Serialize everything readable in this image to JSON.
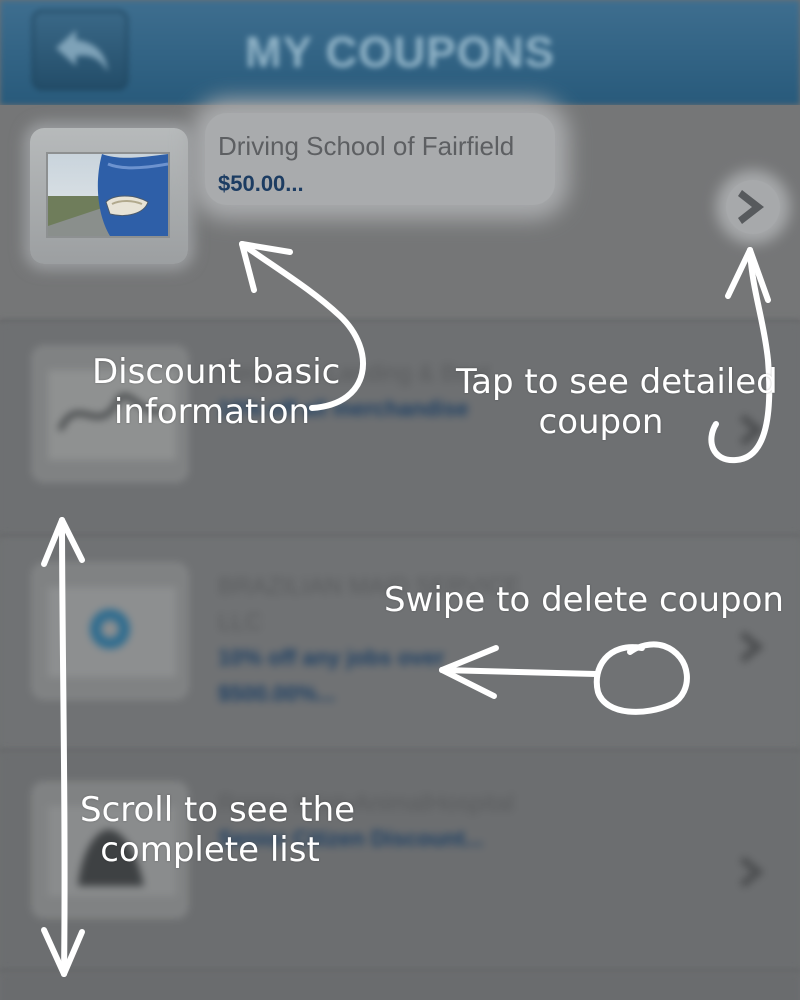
{
  "header": {
    "title": "MY COUPONS",
    "back_icon": "reply-arrow-icon"
  },
  "coupons": [
    {
      "merchant": "Driving School of Fairfield",
      "offer": "$50.00...",
      "thumbnail": "car-headlight-photo"
    },
    {
      "merchant": "Ferguson Landing & Boat",
      "offer": "10% off all merchandise"
    },
    {
      "merchant_line1": "BRAZILIAN MAID SERVICE",
      "merchant_line2": "LLC",
      "offer_line1": "10% off any jobs over",
      "offer_line2": "$500.00%..."
    },
    {
      "merchant": "Ronny KristyAnimalHospital",
      "offer": "Senior Citizen Discount..."
    }
  ],
  "annotations": {
    "discount_line1": "Discount basic",
    "discount_line2": "information",
    "tap_line1": "Tap to see detailed",
    "tap_line2": "coupon",
    "swipe": "Swipe to delete coupon",
    "scroll_line1": "Scroll to see the",
    "scroll_line2": "complete list"
  },
  "colors": {
    "header": "#285a7b",
    "overlay_background": "#6f7172",
    "offer_text": "#1c3c62",
    "annotation": "#ffffff"
  }
}
